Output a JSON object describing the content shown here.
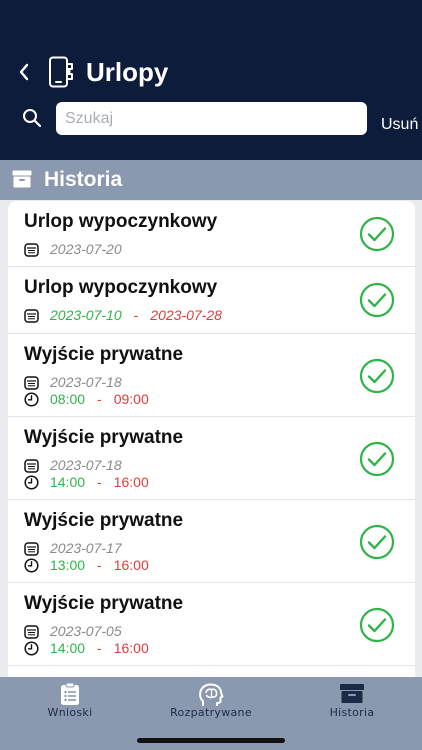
{
  "header": {
    "title": "Urlopy",
    "search_placeholder": "Szukaj",
    "clear_label": "Usuń"
  },
  "section": {
    "title": "Historia"
  },
  "items": [
    {
      "title": "Urlop wypoczynkowy",
      "date_from": "2023-07-20",
      "date_to": "",
      "time_from": "",
      "time_to": "",
      "status_icon": "check-circle-icon"
    },
    {
      "title": "Urlop wypoczynkowy",
      "date_from": "2023-07-10",
      "date_to": "2023-07-28",
      "time_from": "",
      "time_to": "",
      "status_icon": "check-circle-icon"
    },
    {
      "title": "Wyjście prywatne",
      "date_from": "2023-07-18",
      "date_to": "",
      "time_from": "08:00",
      "time_to": "09:00",
      "status_icon": "check-circle-icon"
    },
    {
      "title": "Wyjście prywatne",
      "date_from": "2023-07-18",
      "date_to": "",
      "time_from": "14:00",
      "time_to": "16:00",
      "status_icon": "check-circle-icon"
    },
    {
      "title": "Wyjście prywatne",
      "date_from": "2023-07-17",
      "date_to": "",
      "time_from": "13:00",
      "time_to": "16:00",
      "status_icon": "check-circle-icon"
    },
    {
      "title": "Wyjście prywatne",
      "date_from": "2023-07-05",
      "date_to": "",
      "time_from": "14:00",
      "time_to": "16:00",
      "status_icon": "check-circle-icon"
    }
  ],
  "range_separator": "-",
  "tabs": [
    {
      "label": "Wnioski",
      "icon": "clipboard-list-icon",
      "active": false
    },
    {
      "label": "Rozpatrywane",
      "icon": "brain-head-icon",
      "active": false
    },
    {
      "label": "Historia",
      "icon": "archive-box-icon",
      "active": true
    }
  ],
  "colors": {
    "header_bg": "#0d1c3b",
    "section_bg": "#8b99b0",
    "approved_green": "#2fb44a",
    "end_red": "#e43a3a"
  }
}
